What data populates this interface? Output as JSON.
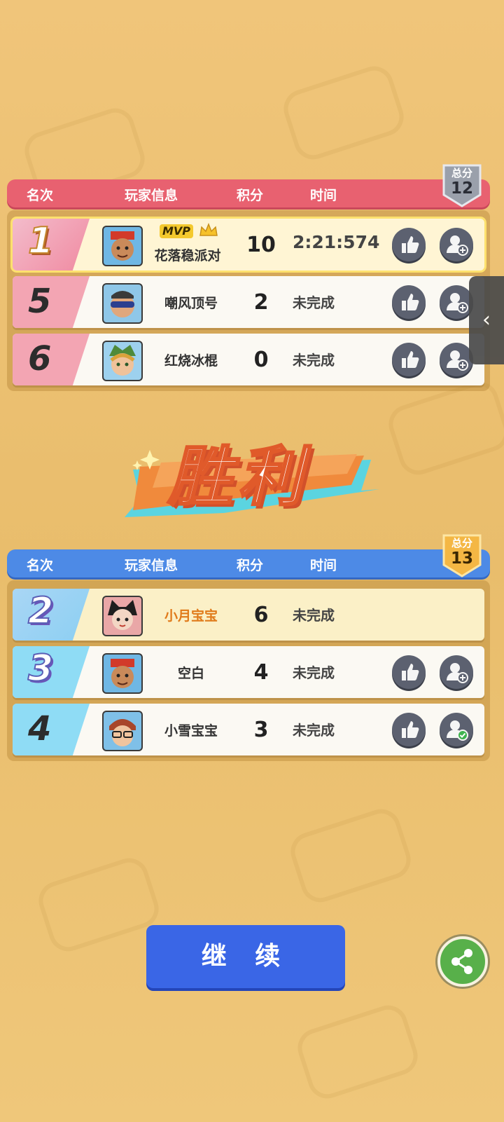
{
  "top_panel": {
    "headers": {
      "rank": "名次",
      "player": "玩家信息",
      "score": "积分",
      "time": "时间"
    },
    "total": {
      "label": "总分",
      "value": "12"
    },
    "rows": [
      {
        "rank": "1",
        "mvp": "MVP",
        "name": "花落稳派对",
        "score": "10",
        "time": "2:21:574"
      },
      {
        "rank": "5",
        "name": "嘲风顶号",
        "score": "2",
        "time": "未完成"
      },
      {
        "rank": "6",
        "name": "红烧冰棍",
        "score": "0",
        "time": "未完成"
      }
    ]
  },
  "banner": {
    "text": "胜利"
  },
  "bottom_panel": {
    "headers": {
      "rank": "名次",
      "player": "玩家信息",
      "score": "积分",
      "time": "时间"
    },
    "total": {
      "label": "总分",
      "value": "13"
    },
    "rows": [
      {
        "rank": "2",
        "name": "小月宝宝",
        "score": "6",
        "time": "未完成"
      },
      {
        "rank": "3",
        "name": "空白",
        "score": "4",
        "time": "未完成"
      },
      {
        "rank": "4",
        "name": "小雪宝宝",
        "score": "3",
        "time": "未完成"
      }
    ]
  },
  "actions": {
    "continue": "继 续",
    "side_tab_glyph": "‹"
  },
  "icons": {
    "like": "thumbs-up-icon",
    "add_friend": "add-friend-icon",
    "friend_added": "friend-added-icon",
    "share": "share-icon"
  },
  "colors": {
    "red_team": "#e86170",
    "blue_team": "#4d8ae6",
    "continue_button": "#3a66e6",
    "share_button": "#58b04a"
  }
}
